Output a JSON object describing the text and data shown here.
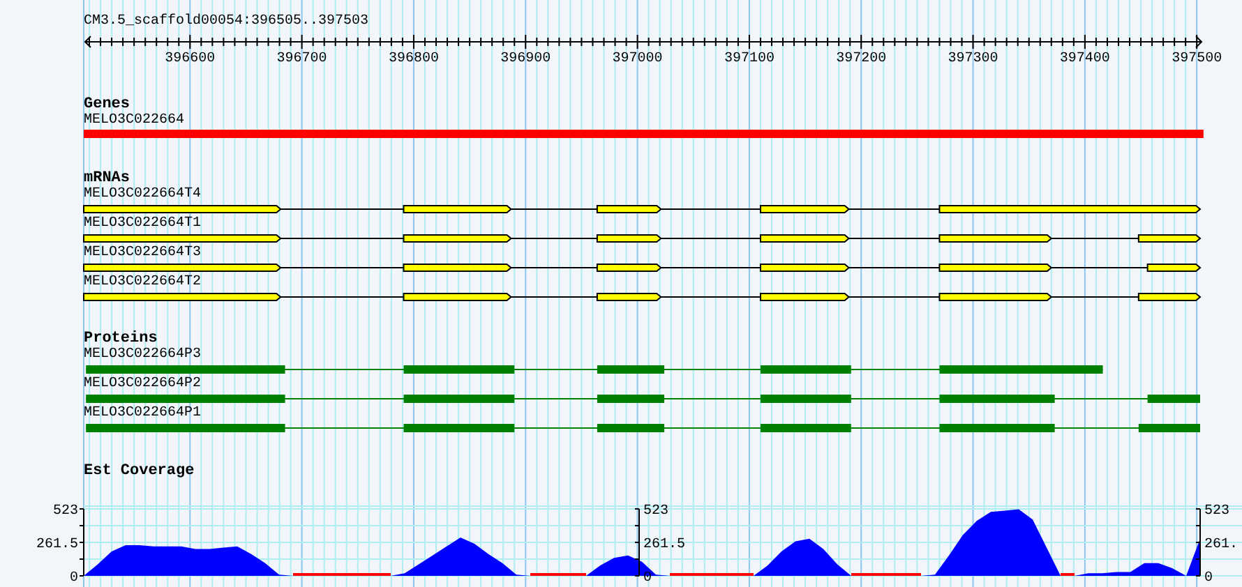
{
  "region": "CM3.5_scaffold00054:396505..397503",
  "ruler": {
    "labels": [
      "396600",
      "396700",
      "396800",
      "396900",
      "397000",
      "397100",
      "397200",
      "397300",
      "397400",
      "397500"
    ]
  },
  "tracks": [
    {
      "kind": "gene",
      "title": "Genes",
      "features": [
        {
          "name": "MELO3C022664"
        }
      ]
    },
    {
      "kind": "mrna",
      "title": "mRNAs",
      "features": [
        {
          "name": "MELO3C022664T4"
        },
        {
          "name": "MELO3C022664T1"
        },
        {
          "name": "MELO3C022664T3"
        },
        {
          "name": "MELO3C022664T2"
        }
      ]
    },
    {
      "kind": "protein",
      "title": "Proteins",
      "features": [
        {
          "name": "MELO3C022664P3"
        },
        {
          "name": "MELO3C022664P2"
        },
        {
          "name": "MELO3C022664P1"
        }
      ]
    }
  ],
  "coverage": {
    "chart_data": {
      "type": "area",
      "title": "Est Coverage",
      "ylim": [
        0,
        523
      ],
      "yticks": [
        0,
        {
          "value": 261.5,
          "label": "261.5"
        },
        523
      ],
      "categories": [
        null,
        null,
        null,
        null,
        null,
        null,
        null,
        null,
        null,
        null,
        null,
        null,
        null,
        null,
        null,
        null,
        null,
        null,
        null,
        null,
        null,
        null,
        null,
        null,
        null,
        null,
        null,
        null,
        null,
        null,
        null,
        null,
        null,
        null,
        null,
        null,
        null,
        null,
        null,
        null,
        null,
        null,
        null,
        null,
        null,
        null,
        null,
        null,
        null,
        null,
        null,
        null,
        null,
        null,
        null,
        null,
        null,
        null,
        null,
        null,
        null,
        null,
        null,
        null,
        null,
        null,
        null,
        null,
        null,
        null,
        null,
        null,
        null,
        null,
        null,
        null,
        null,
        null,
        null,
        null,
        null
      ],
      "series": [
        {
          "color": "#0000ff",
          "values": [
            0,
            90,
            190,
            240,
            240,
            230,
            230,
            230,
            210,
            210,
            220,
            230,
            170,
            100,
            10,
            0,
            0,
            0,
            0,
            0,
            0,
            0,
            0,
            20,
            90,
            160,
            230,
            300,
            250,
            170,
            100,
            10,
            0,
            0,
            0,
            0,
            0,
            80,
            140,
            160,
            110,
            10,
            0,
            0,
            0,
            0,
            0,
            0,
            0,
            80,
            190,
            270,
            290,
            210,
            90,
            0,
            0,
            0,
            0,
            0,
            0,
            10,
            160,
            320,
            430,
            500,
            510,
            520,
            440,
            220,
            0,
            0,
            20,
            20,
            30,
            30,
            100,
            100,
            60,
            0,
            290
          ]
        }
      ]
    },
    "extra_axes": [
      {
        "labels": [
          "523",
          "261.5",
          "0"
        ]
      },
      {
        "labels": [
          "523",
          "261.",
          "0"
        ]
      }
    ]
  }
}
